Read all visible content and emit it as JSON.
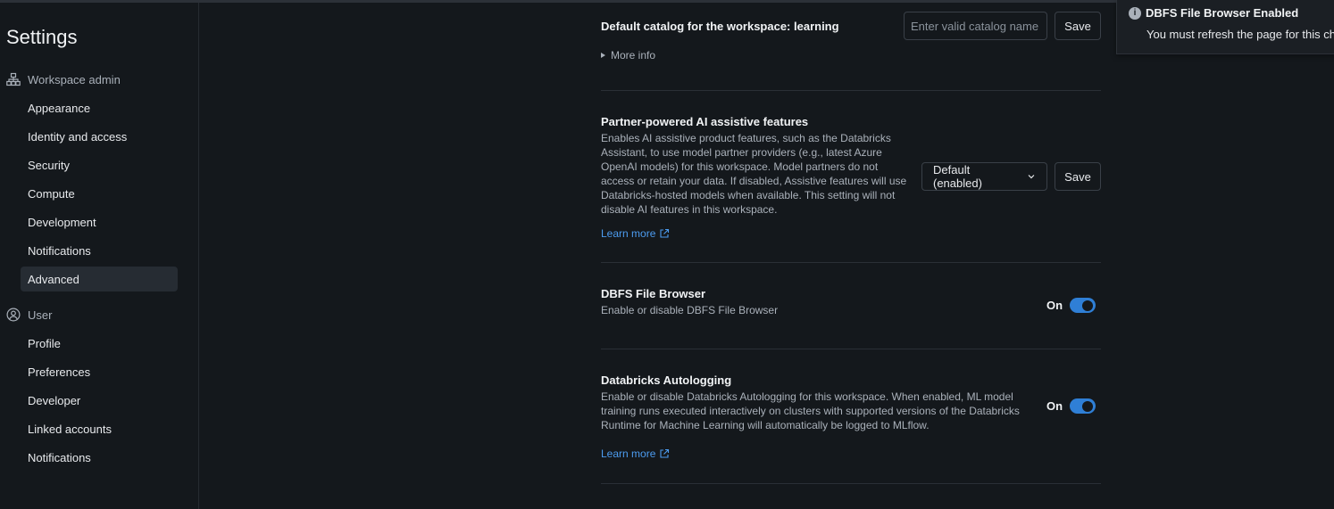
{
  "sidebar": {
    "title": "Settings",
    "workspace_admin": {
      "label": "Workspace admin",
      "icon": "org-chart-icon",
      "items": [
        {
          "label": "Appearance"
        },
        {
          "label": "Identity and access"
        },
        {
          "label": "Security"
        },
        {
          "label": "Compute"
        },
        {
          "label": "Development"
        },
        {
          "label": "Notifications"
        },
        {
          "label": "Advanced",
          "active": true
        }
      ]
    },
    "user": {
      "label": "User",
      "icon": "user-circle-icon",
      "items": [
        {
          "label": "Profile"
        },
        {
          "label": "Preferences"
        },
        {
          "label": "Developer"
        },
        {
          "label": "Linked accounts"
        },
        {
          "label": "Notifications"
        }
      ]
    }
  },
  "settings": {
    "default_catalog": {
      "title_prefix": "Default catalog for the workspace: ",
      "title_value": "learning",
      "more_info": "More info",
      "input_placeholder": "Enter valid catalog name",
      "input_value": "",
      "save_label": "Save"
    },
    "partner_ai": {
      "title": "Partner-powered AI assistive features",
      "desc_lines": [
        "Enables AI assistive product features, such as the Databricks",
        "Assistant, to use model partner providers (e.g., latest Azure",
        "OpenAI models) for this workspace. Model partners do not",
        "access or retain your data. If disabled, Assistive features will use",
        "Databricks-hosted models when available. This setting will not",
        "disable AI features in this workspace."
      ],
      "learn_more": "Learn more",
      "select_value": "Default (enabled)",
      "save_label": "Save"
    },
    "dbfs": {
      "title": "DBFS File Browser",
      "desc": "Enable or disable DBFS File Browser",
      "toggle_label": "On",
      "enabled": true
    },
    "autologging": {
      "title": "Databricks Autologging",
      "desc_lines": [
        "Enable or disable Databricks Autologging for this workspace. When enabled, ML model",
        "training runs executed interactively on clusters with supported versions of the Databricks",
        "Runtime for Machine Learning will automatically be logged to MLflow."
      ],
      "learn_more": "Learn more",
      "toggle_label": "On",
      "enabled": true
    }
  },
  "toast": {
    "icon": "info-icon",
    "title": "DBFS File Browser Enabled",
    "message": "You must refresh the page for this ch"
  },
  "colors": {
    "background": "#14181c",
    "accent": "#2f7fd6",
    "link": "#4c9cf0"
  }
}
